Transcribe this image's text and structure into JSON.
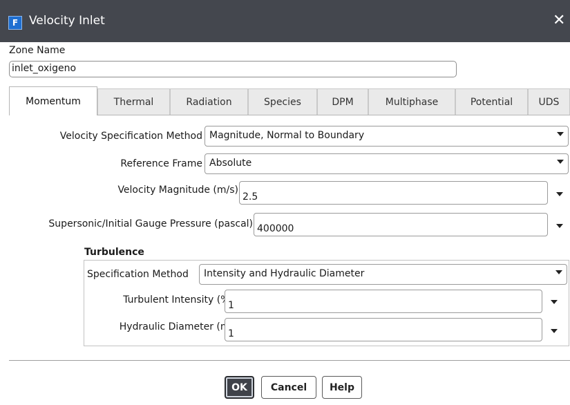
{
  "window": {
    "title": "Velocity Inlet",
    "app_icon_letter": "F",
    "close_glyph": "✕"
  },
  "zone": {
    "label": "Zone Name",
    "value": "inlet_oxigeno"
  },
  "tabs": [
    {
      "label": "Momentum",
      "active": true
    },
    {
      "label": "Thermal",
      "active": false
    },
    {
      "label": "Radiation",
      "active": false
    },
    {
      "label": "Species",
      "active": false
    },
    {
      "label": "DPM",
      "active": false
    },
    {
      "label": "Multiphase",
      "active": false
    },
    {
      "label": "Potential",
      "active": false
    },
    {
      "label": "UDS",
      "active": false
    }
  ],
  "momentum": {
    "velocity_spec": {
      "label": "Velocity Specification Method",
      "value": "Magnitude, Normal to Boundary"
    },
    "reference_frame": {
      "label": "Reference Frame",
      "value": "Absolute"
    },
    "velocity_magnitude": {
      "label": "Velocity Magnitude (m/s)",
      "value": "2.5"
    },
    "gauge_pressure": {
      "label": "Supersonic/Initial Gauge Pressure (pascal)",
      "value": "400000"
    }
  },
  "turbulence": {
    "title": "Turbulence",
    "spec_method": {
      "label": "Specification Method",
      "value": "Intensity and Hydraulic Diameter"
    },
    "intensity": {
      "label": "Turbulent Intensity (%)",
      "value": "1"
    },
    "hydraulic_diameter": {
      "label": "Hydraulic Diameter (m)",
      "value": "1"
    }
  },
  "buttons": {
    "ok": "OK",
    "cancel": "Cancel",
    "help": "Help"
  }
}
